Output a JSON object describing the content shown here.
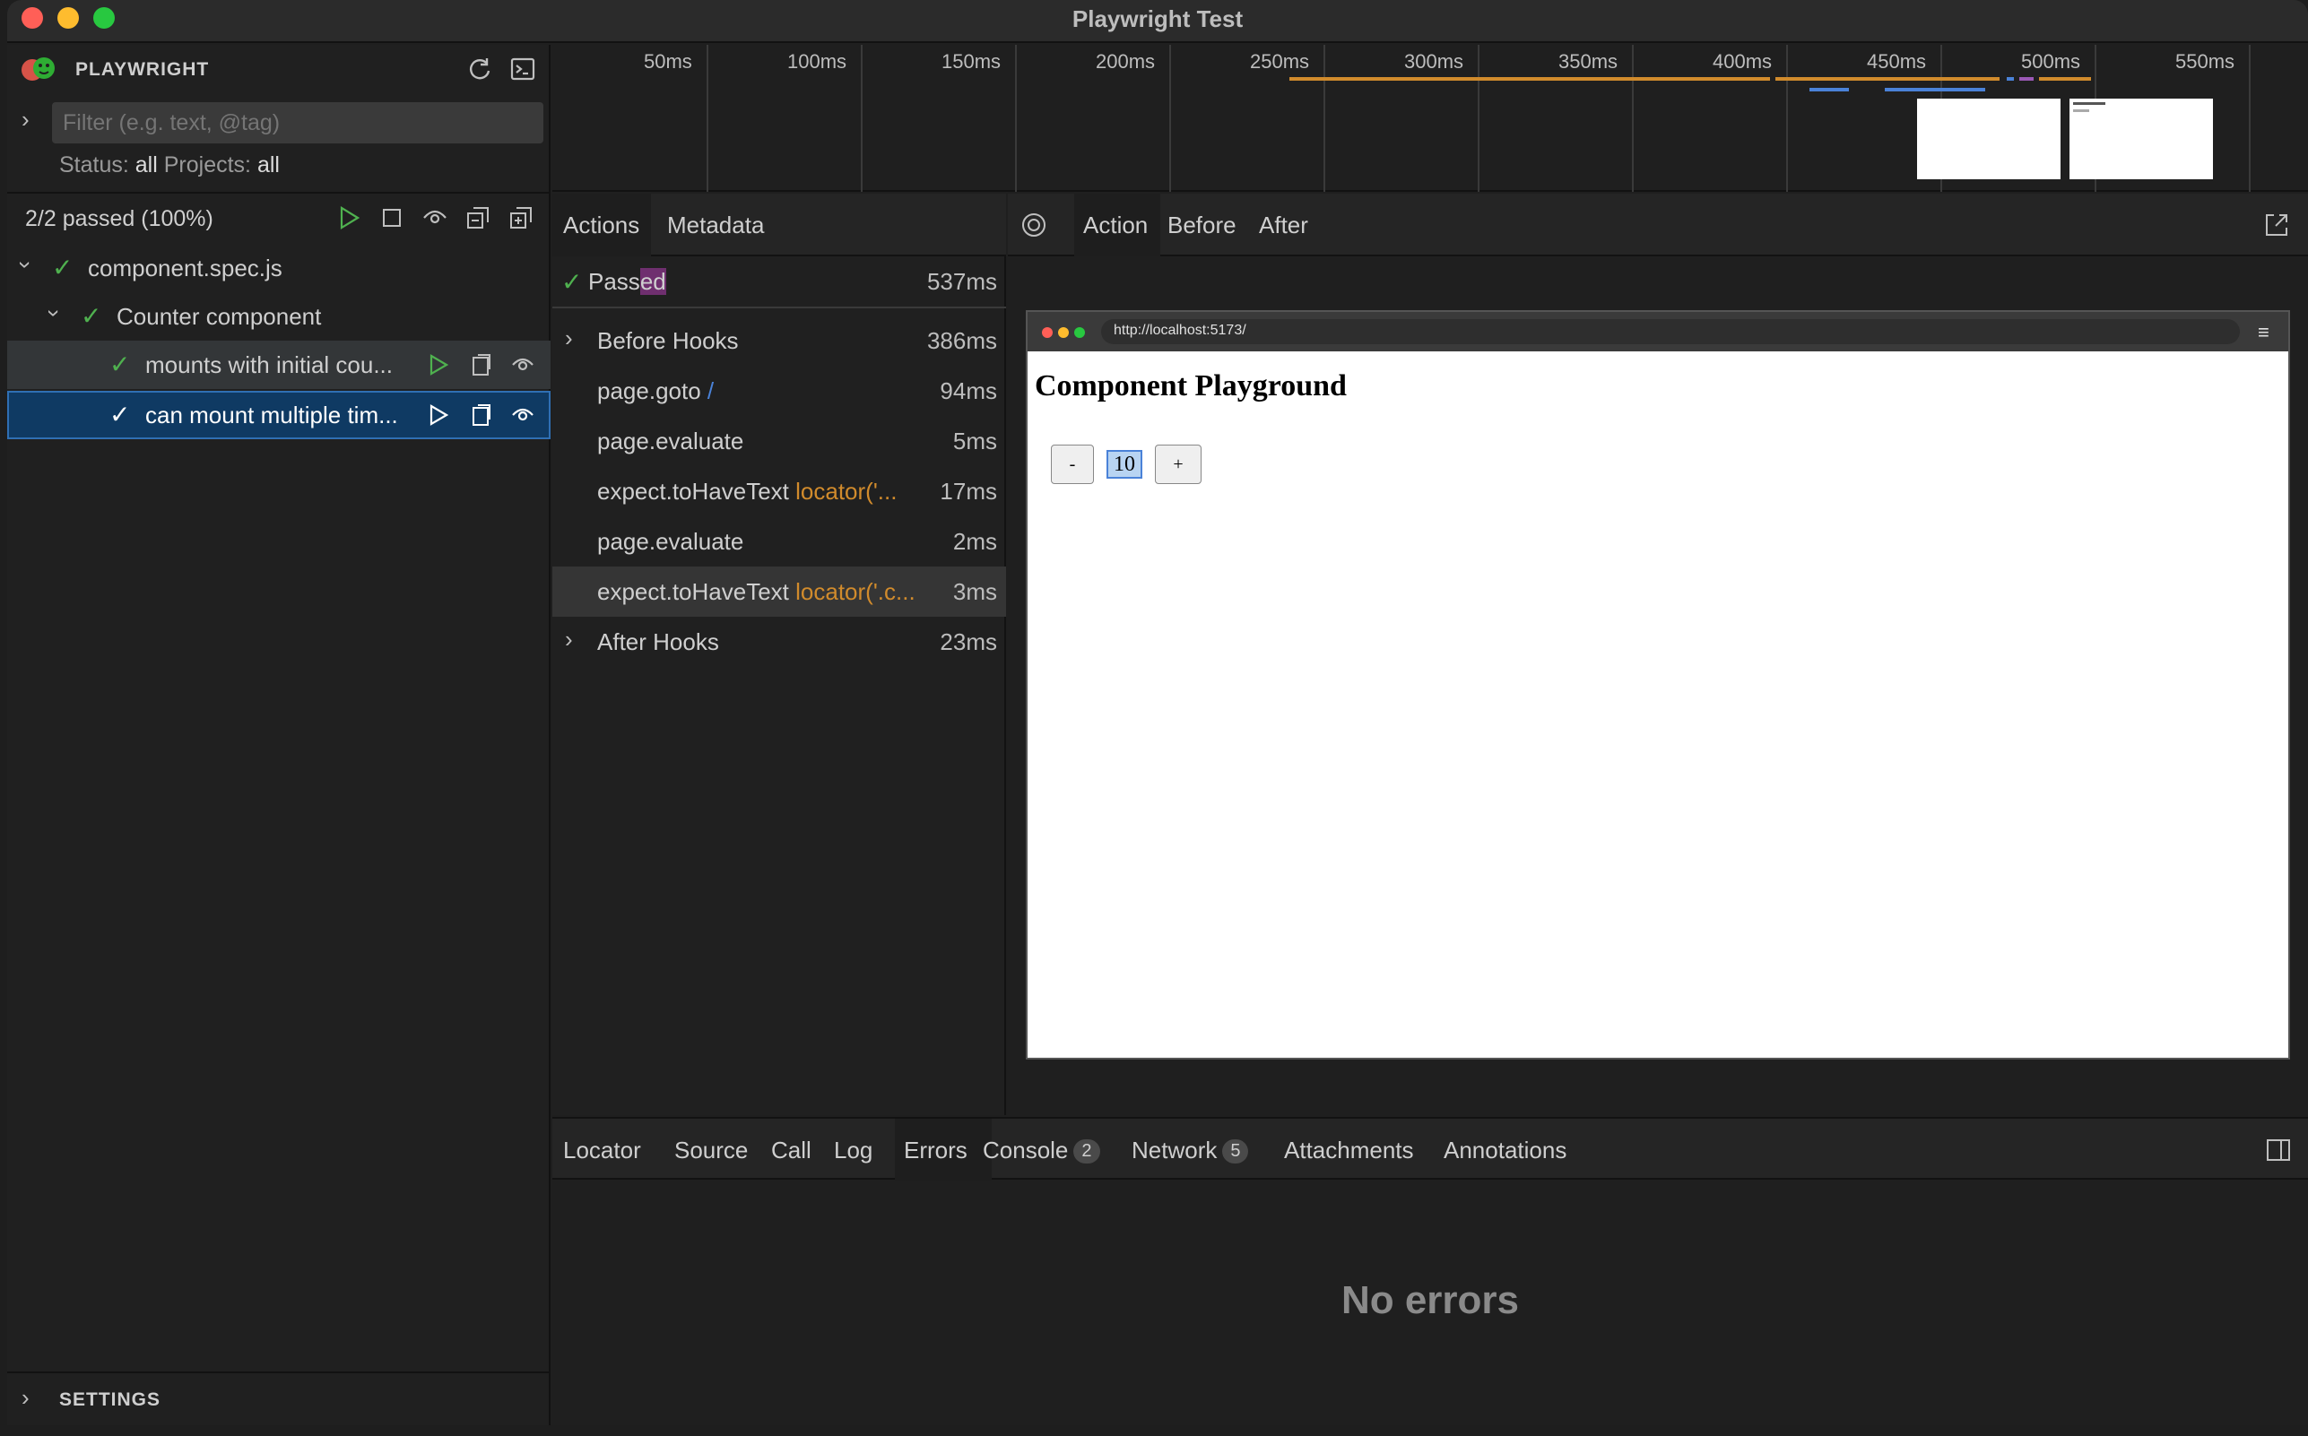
{
  "window": {
    "title": "Playwright Test",
    "traffic_colors": [
      "#ff5f57",
      "#febc2e",
      "#28c840"
    ]
  },
  "sidebar": {
    "brand": "PLAYWRIGHT",
    "filter_placeholder": "Filter (e.g. text, @tag)",
    "status_label": "Status:",
    "status_value": "all",
    "projects_label": "Projects:",
    "projects_value": "all",
    "summary": "2/2 passed (100%)",
    "tree": {
      "file": "component.spec.js",
      "suite": "Counter component",
      "tests": [
        "mounts with initial cou...",
        "can mount multiple tim..."
      ]
    },
    "settings": "SETTINGS"
  },
  "timeline": {
    "ticks": [
      "50ms",
      "100ms",
      "150ms",
      "200ms",
      "250ms",
      "300ms",
      "350ms",
      "400ms",
      "450ms",
      "500ms",
      "550ms"
    ],
    "accent": "#d18b2c",
    "secondary": "#4a82d8"
  },
  "actions": {
    "tabs": [
      "Actions",
      "Metadata"
    ],
    "status": "Passed",
    "status_highlight": "ed",
    "status_prefix": "Pass",
    "total_time": "537ms",
    "rows": [
      {
        "name": "Before Hooks",
        "locator": "",
        "time": "386ms",
        "expandable": true
      },
      {
        "name": "page.goto",
        "locator": "/",
        "time": "94ms",
        "expandable": false
      },
      {
        "name": "page.evaluate",
        "locator": "",
        "time": "5ms",
        "expandable": false
      },
      {
        "name": "expect.toHaveText",
        "locator": "locator('...",
        "time": "17ms",
        "expandable": false
      },
      {
        "name": "page.evaluate",
        "locator": "",
        "time": "2ms",
        "expandable": false
      },
      {
        "name": "expect.toHaveText",
        "locator": "locator('.c...",
        "time": "3ms",
        "expandable": false
      },
      {
        "name": "After Hooks",
        "locator": "",
        "time": "23ms",
        "expandable": true
      }
    ]
  },
  "snapshot": {
    "tabs": [
      "Action",
      "Before",
      "After"
    ],
    "url": "http://localhost:5173/",
    "page_title": "Component Playground",
    "minus": "-",
    "count": "10",
    "plus": "+"
  },
  "bottom": {
    "tabs": [
      "Locator",
      "Source",
      "Call",
      "Log",
      "Errors",
      "Console",
      "Network",
      "Attachments",
      "Annotations"
    ],
    "console_count": "2",
    "network_count": "5",
    "empty_message": "No errors"
  }
}
